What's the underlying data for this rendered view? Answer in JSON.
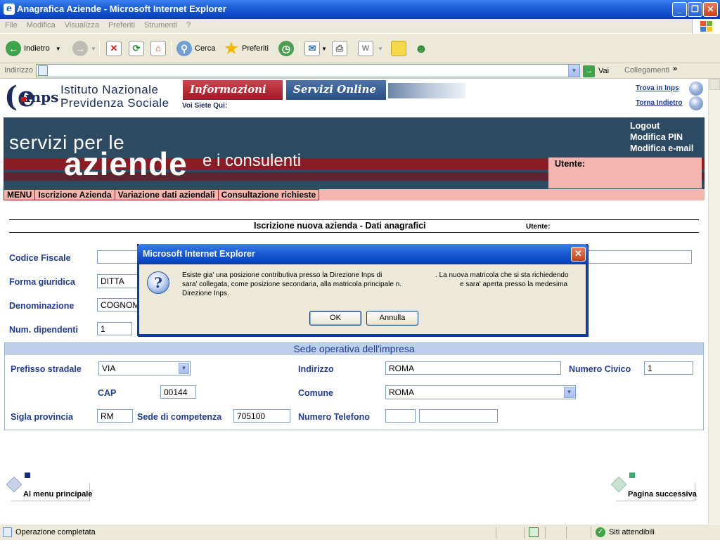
{
  "window": {
    "title": "Anagrafica Aziende - Microsoft Internet Explorer"
  },
  "menu": [
    "File",
    "Modifica",
    "Visualizza",
    "Preferiti",
    "Strumenti",
    "?"
  ],
  "toolbar": {
    "back": "Indietro",
    "search": "Cerca",
    "favorites": "Preferiti"
  },
  "address": {
    "label": "Indirizzo",
    "value": "",
    "go": "Vai",
    "links": "Collegamenti"
  },
  "header": {
    "institute_line1": "Istituto Nazionale",
    "institute_line2": "Previdenza Sociale",
    "tab_info": "Informazioni",
    "tab_online": "Servizi Online",
    "you_are_here": "Voi Siete Qui:",
    "find_inps": "Trova in Inps",
    "go_back": "Torna Indietro"
  },
  "hero": {
    "line1": "servizi per le",
    "line2": "aziende",
    "line3": "e i consulenti",
    "logout": "Logout",
    "change_pin": "Modifica PIN",
    "change_email": "Modifica e-mail",
    "user_label": "Utente:"
  },
  "nav": [
    "MENU",
    "Iscrizione Azienda",
    "Variazione dati aziendali",
    "Consultazione richieste"
  ],
  "form": {
    "title": "Iscrizione nuova azienda - Dati anagrafici",
    "user_label": "Utente:",
    "codice_fiscale_label": "Codice Fiscale",
    "codice_fiscale_value": "",
    "forma_label": "Forma giuridica",
    "forma_value": "DITTA",
    "denominazione_label": "Denominazione",
    "denominazione_value": "COGNOM",
    "dipendenti_label": "Num. dipendenti",
    "dipendenti_value": "1"
  },
  "sede": {
    "title": "Sede operativa dell'impresa",
    "prefisso_label": "Prefisso stradale",
    "prefisso_value": "VIA",
    "indirizzo_label": "Indirizzo",
    "indirizzo_value": "ROMA",
    "civico_label": "Numero Civico",
    "civico_value": "1",
    "cap_label": "CAP",
    "cap_value": "00144",
    "comune_label": "Comune",
    "comune_value": "ROMA",
    "provincia_label": "Sigla provincia",
    "provincia_value": "RM",
    "competenza_label": "Sede di competenza",
    "competenza_value": "705100",
    "telefono_label": "Numero Telefono",
    "telefono_prefix": "",
    "telefono_value": ""
  },
  "footer": {
    "menu_link": "Al menu principale",
    "next_link": "Pagina successiva"
  },
  "status": {
    "text": "Operazione completata",
    "zone": "Siti attendibili"
  },
  "dialog": {
    "title": "Microsoft Internet Explorer",
    "line1a": "Esiste gia' una posizione contributiva presso la Direzione Inps di",
    "line1b": ". La nuova matricola che si sta richiedendo",
    "line2a": "sara' collegata, come posizione secondaria, alla matricola principale n.",
    "line2b": "e sara' aperta presso la medesima",
    "line3": "Direzione Inps.",
    "ok": "OK",
    "cancel": "Annulla"
  },
  "colors": {
    "titlebar": "#0a46c4",
    "hero_bg": "#2d4a63",
    "accent_red": "#8a1c24",
    "label_blue": "#223c94",
    "nav_pink": "#f3b5ad"
  }
}
